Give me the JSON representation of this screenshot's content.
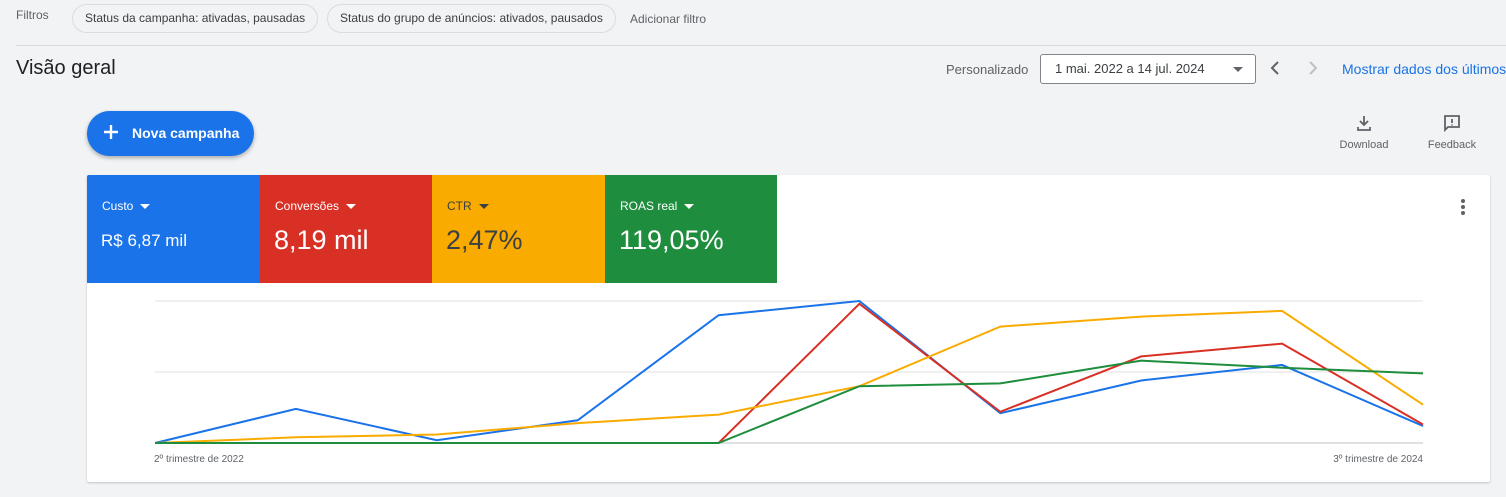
{
  "filters": {
    "label": "Filtros",
    "chips": [
      {
        "label": "Status da campanha: ativadas, pausadas"
      },
      {
        "label": "Status do grupo de anúncios: ativados, pausados"
      }
    ],
    "add_filter": "Adicionar filtro"
  },
  "header": {
    "title": "Visão geral",
    "range_type": "Personalizado",
    "date_range": "1 mai. 2022 a 14 jul. 2024",
    "show_last": "Mostrar dados dos últimos"
  },
  "actions": {
    "new_campaign": "Nova campanha",
    "download": "Download",
    "feedback": "Feedback"
  },
  "metrics": [
    {
      "label": "Custo",
      "value": "R$ 6,87 mil",
      "color": "#1a73e8"
    },
    {
      "label": "Conversões",
      "value": "8,19 mil",
      "color": "#d93025"
    },
    {
      "label": "CTR",
      "value": "2,47%",
      "color": "#f9ab00"
    },
    {
      "label": "ROAS real",
      "value": "119,05%",
      "color": "#1e8e3e"
    }
  ],
  "chart_data": {
    "type": "line",
    "x_tick_labels": [
      "2º trimestre de 2022",
      "3º trimestre de 2024"
    ],
    "x": [
      1,
      2,
      3,
      4,
      5,
      6,
      7,
      8,
      9,
      10
    ],
    "ylim": [
      0,
      1
    ],
    "grid": true,
    "series": [
      {
        "color": "#1a73e8",
        "values": [
          0.0,
          0.24,
          0.02,
          0.16,
          0.9,
          1.0,
          0.21,
          0.44,
          0.55,
          0.12
        ]
      },
      {
        "color": "#d93025",
        "values": [
          0.0,
          0.0,
          0.0,
          0.0,
          0.0,
          0.98,
          0.22,
          0.61,
          0.7,
          0.13
        ]
      },
      {
        "color": "#f9ab00",
        "values": [
          0.0,
          0.04,
          0.06,
          0.14,
          0.2,
          0.4,
          0.82,
          0.89,
          0.93,
          0.27
        ]
      },
      {
        "color": "#1e8e3e",
        "values": [
          0.0,
          0.0,
          0.0,
          0.0,
          0.0,
          0.4,
          0.42,
          0.58,
          0.53,
          0.49
        ]
      }
    ]
  }
}
